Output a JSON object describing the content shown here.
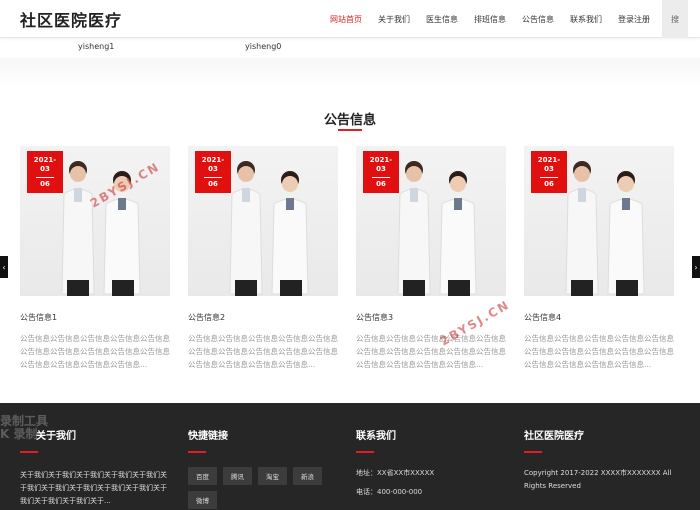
{
  "site": {
    "title": "社区医院医疗"
  },
  "nav": {
    "items": [
      "网站首页",
      "关于我们",
      "医生信息",
      "排班信息",
      "公告信息",
      "联系我们",
      "登录注册"
    ],
    "active_index": 0,
    "search_label": "搜"
  },
  "doctors": [
    "yisheng1",
    "yisheng0"
  ],
  "section": {
    "title": "公告信息"
  },
  "cards": [
    {
      "year": "2021-",
      "month": "03",
      "day": "06",
      "title": "公告信息1",
      "desc": "公告信息公告信息公告信息公告信息公告信息公告信息公告信息公告信息公告信息公告信息公告信息公告信息公告信息公告信息..."
    },
    {
      "year": "2021-",
      "month": "03",
      "day": "06",
      "title": "公告信息2",
      "desc": "公告信息公告信息公告信息公告信息公告信息公告信息公告信息公告信息公告信息公告信息公告信息公告信息公告信息公告信息..."
    },
    {
      "year": "2021-",
      "month": "03",
      "day": "06",
      "title": "公告信息3",
      "desc": "公告信息公告信息公告信息公告信息公告信息公告信息公告信息公告信息公告信息公告信息公告信息公告信息公告信息公告信息..."
    },
    {
      "year": "2021-",
      "month": "03",
      "day": "06",
      "title": "公告信息4",
      "desc": "公告信息公告信息公告信息公告信息公告信息公告信息公告信息公告信息公告信息公告信息公告信息公告信息公告信息公告信息..."
    }
  ],
  "watermarks": [
    "2BYSJ.CN",
    "2BYSJ.CN"
  ],
  "footer": {
    "about": {
      "title": "关于我们",
      "text": "关于我们关于我们关于我们关于我们关于我们关于我们关于我们关于我们关于我们关于我们关于我们关于我们关于我们关于..."
    },
    "links": {
      "title": "快捷链接",
      "items": [
        "百度",
        "腾讯",
        "淘宝",
        "新浪",
        "微博"
      ]
    },
    "contact": {
      "title": "联系我们",
      "address": "地址：XX省XX市XXXXX",
      "phone": "电话：400-000-000"
    },
    "brand": {
      "title": "社区医院医疗",
      "copyright": "Copyright 2017-2022 XXXX市XXXXXXX All Rights Reserved"
    },
    "record_watermark": [
      "录制工具",
      "K 录制"
    ]
  },
  "colors": {
    "accent": "#e02020",
    "footer_bg": "#262626"
  }
}
